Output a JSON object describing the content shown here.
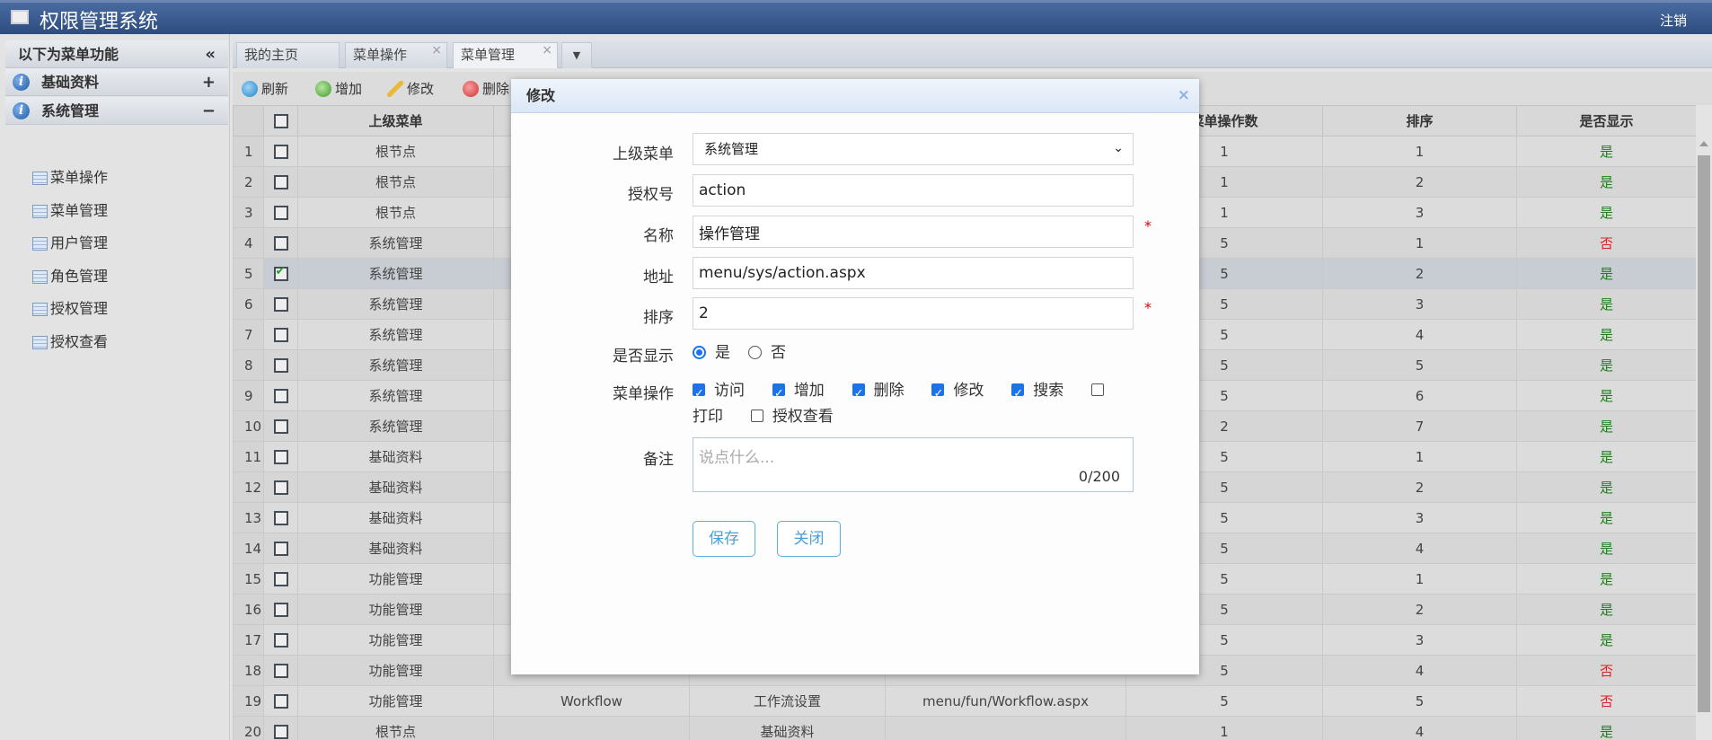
{
  "app": {
    "title": "权限管理系统",
    "logout": "注销"
  },
  "sidebar": {
    "header": "以下为菜单功能",
    "collapse_icon": "«",
    "groups": [
      {
        "label": "基础资料",
        "toggle": "+"
      },
      {
        "label": "系统管理",
        "toggle": "−"
      }
    ],
    "items": [
      "菜单操作",
      "菜单管理",
      "用户管理",
      "角色管理",
      "授权管理",
      "授权查看"
    ]
  },
  "tabs": [
    {
      "label": "我的主页"
    },
    {
      "label": "菜单操作",
      "close": "×"
    },
    {
      "label": "菜单管理",
      "close": "×"
    }
  ],
  "toolbar": {
    "refresh": "刷新",
    "add": "增加",
    "edit": "修改",
    "delete": "删除"
  },
  "table": {
    "columns": [
      "",
      "",
      "上级菜单",
      "",
      "",
      "",
      "菜单操作数",
      "排序",
      "是否显示"
    ],
    "rows": [
      [
        "1",
        false,
        "根节点",
        "",
        "",
        "",
        "1",
        "1",
        "是"
      ],
      [
        "2",
        false,
        "根节点",
        "",
        "",
        "",
        "1",
        "2",
        "是"
      ],
      [
        "3",
        false,
        "根节点",
        "",
        "",
        "",
        "1",
        "3",
        "是"
      ],
      [
        "4",
        false,
        "系统管理",
        "",
        "",
        "",
        "5",
        "1",
        "否"
      ],
      [
        "5",
        true,
        "系统管理",
        "",
        "",
        "",
        "5",
        "2",
        "是"
      ],
      [
        "6",
        false,
        "系统管理",
        "",
        "",
        "",
        "5",
        "3",
        "是"
      ],
      [
        "7",
        false,
        "系统管理",
        "",
        "",
        "",
        "5",
        "4",
        "是"
      ],
      [
        "8",
        false,
        "系统管理",
        "",
        "",
        "",
        "5",
        "5",
        "是"
      ],
      [
        "9",
        false,
        "系统管理",
        "",
        "",
        "",
        "5",
        "6",
        "是"
      ],
      [
        "10",
        false,
        "系统管理",
        "",
        "",
        "",
        "2",
        "7",
        "是"
      ],
      [
        "11",
        false,
        "基础资料",
        "",
        "",
        "",
        "5",
        "1",
        "是"
      ],
      [
        "12",
        false,
        "基础资料",
        "",
        "",
        "",
        "5",
        "2",
        "是"
      ],
      [
        "13",
        false,
        "基础资料",
        "",
        "",
        "",
        "5",
        "3",
        "是"
      ],
      [
        "14",
        false,
        "基础资料",
        "",
        "",
        "",
        "5",
        "4",
        "是"
      ],
      [
        "15",
        false,
        "功能管理",
        "",
        "",
        "",
        "5",
        "1",
        "是"
      ],
      [
        "16",
        false,
        "功能管理",
        "",
        "",
        "",
        "5",
        "2",
        "是"
      ],
      [
        "17",
        false,
        "功能管理",
        "",
        "",
        "",
        "5",
        "3",
        "是"
      ],
      [
        "18",
        false,
        "功能管理",
        "",
        "",
        "",
        "5",
        "4",
        "否"
      ],
      [
        "19",
        false,
        "功能管理",
        "Workflow",
        "工作流设置",
        "menu/fun/Workflow.aspx",
        "5",
        "5",
        "否"
      ],
      [
        "20",
        false,
        "根节点",
        "",
        "基础资料",
        "",
        "1",
        "4",
        "是"
      ]
    ],
    "colors": {
      "yes": "#1f7d1f",
      "no": "#dd2222"
    }
  },
  "dialog": {
    "title": "修改",
    "close": "×",
    "labels": {
      "parent": "上级菜单",
      "auth": "授权号",
      "name": "名称",
      "url": "地址",
      "order": "排序",
      "visible": "是否显示",
      "ops": "菜单操作",
      "note": "备注"
    },
    "parent_value": "系统管理",
    "auth_value": "action",
    "name_value": "操作管理",
    "url_value": "menu/sys/action.aspx",
    "order_value": "2",
    "required_mark": "*",
    "visible_options": [
      {
        "label": "是",
        "checked": true
      },
      {
        "label": "否",
        "checked": false
      }
    ],
    "ops": [
      {
        "label": "访问",
        "checked": true
      },
      {
        "label": "增加",
        "checked": true
      },
      {
        "label": "删除",
        "checked": true
      },
      {
        "label": "修改",
        "checked": true
      },
      {
        "label": "搜索",
        "checked": true
      },
      {
        "label": "打印",
        "checked": false
      },
      {
        "label": "授权查看",
        "checked": false
      }
    ],
    "note_placeholder": "说点什么...",
    "note_count": "0/200",
    "save": "保存",
    "cancel": "关闭"
  }
}
